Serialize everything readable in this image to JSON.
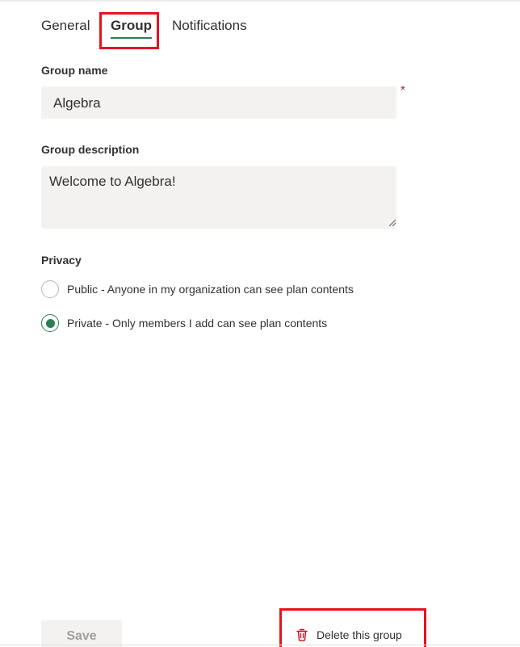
{
  "tabs": {
    "general": "General",
    "group": "Group",
    "notifications": "Notifications",
    "active": "Group"
  },
  "form": {
    "group_name_label": "Group name",
    "group_name_value": "Algebra",
    "required_marker": "*",
    "group_description_label": "Group description",
    "group_description_value": "Welcome to Algebra!",
    "privacy_label": "Privacy",
    "privacy_options": [
      {
        "label": "Public - Anyone in my organization can see plan contents",
        "selected": false
      },
      {
        "label": "Private - Only members I add can see plan contents",
        "selected": true
      }
    ]
  },
  "footer": {
    "save_label": "Save",
    "delete_label": "Delete this group"
  },
  "colors": {
    "accent": "#2e7d52",
    "highlight": "#e8121f",
    "delete_icon": "#c50f1f",
    "required": "#a4262c"
  },
  "icons": {
    "delete": "trash-icon"
  }
}
